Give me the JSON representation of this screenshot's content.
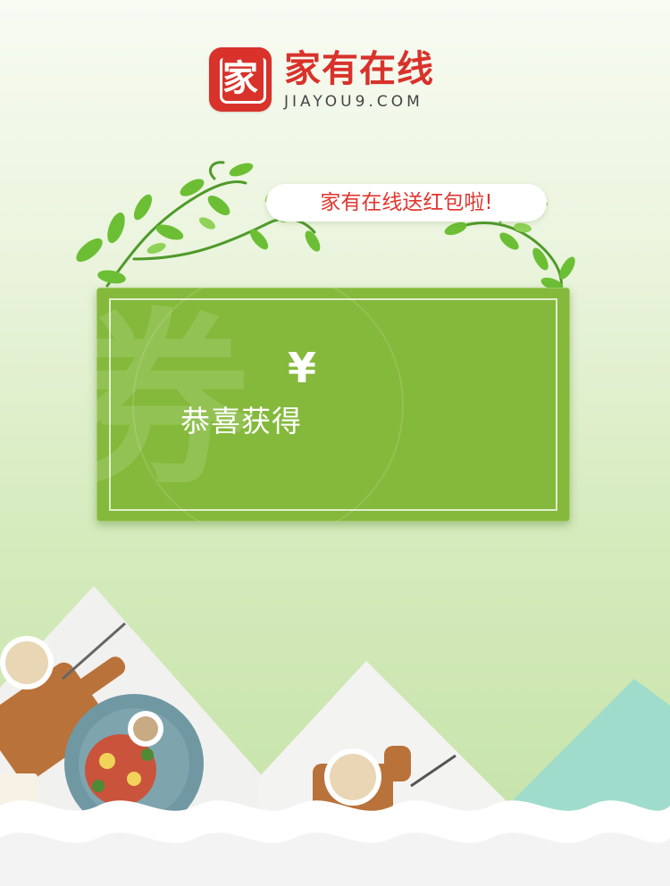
{
  "brand": {
    "logo_glyph": "家",
    "name_cn": "家有在线",
    "name_en": "JIAYOU9.COM",
    "color": "#d8322b"
  },
  "banner": {
    "text": "家有在线送红包啦!",
    "color": "#e0352e"
  },
  "coupon": {
    "currency_symbol": "¥",
    "congrats_text": "恭喜获得",
    "watermark_char": "券",
    "bg_color": "#84b93b"
  },
  "icons": [
    "logo-icon",
    "vine-decoration",
    "food-photo",
    "mountain-shapes",
    "wave-border"
  ]
}
